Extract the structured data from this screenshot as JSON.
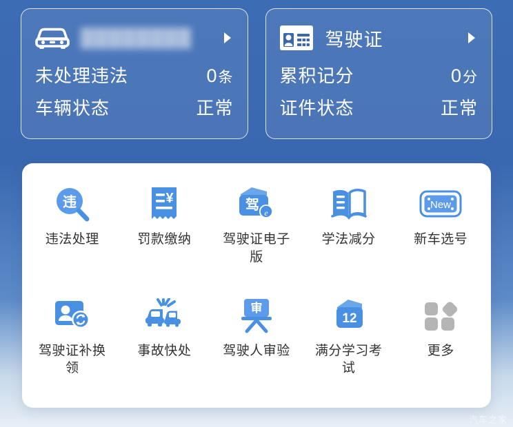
{
  "theme": {
    "bg_top": "#3c6cb4",
    "bg_bottom": "#e8eef5",
    "panel_bg": "#ffffff",
    "icon_blue": "#4a90e2",
    "icon_blue_dark": "#3b82d6",
    "icon_gray": "#b5b5b5",
    "label_color": "#333333",
    "card_text": "#ffffff"
  },
  "cards": [
    {
      "icon": "car-front-icon",
      "title": "████████",
      "title_redacted": true,
      "chevron": "chevron-right-icon",
      "rows": [
        {
          "label": "未处理违法",
          "value": "0",
          "unit": "条"
        },
        {
          "label": "车辆状态",
          "value": "正常",
          "unit": ""
        }
      ]
    },
    {
      "icon": "id-card-icon",
      "title": "驾驶证",
      "title_redacted": false,
      "chevron": "chevron-right-icon",
      "rows": [
        {
          "label": "累积记分",
          "value": "0",
          "unit": "分"
        },
        {
          "label": "证件状态",
          "value": "正常",
          "unit": ""
        }
      ]
    }
  ],
  "grid": {
    "tiles": [
      {
        "id": "violation-handling",
        "label": "违法处理",
        "icon": "violation-search-icon",
        "icon_text": "违"
      },
      {
        "id": "fine-payment",
        "label": "罚款缴纳",
        "icon": "receipt-yuan-icon",
        "icon_text": "¥"
      },
      {
        "id": "e-driver-license",
        "label": "驾驶证电子版",
        "icon": "e-license-wallet-icon",
        "icon_text": "驾"
      },
      {
        "id": "study-law-points",
        "label": "学法减分",
        "icon": "open-book-icon",
        "icon_text": ""
      },
      {
        "id": "new-plate-selection",
        "label": "新车选号",
        "icon": "new-plate-icon",
        "icon_text": "New"
      },
      {
        "id": "license-replacement",
        "label": "驾驶证补换领",
        "icon": "card-person-refresh-icon",
        "icon_text": ""
      },
      {
        "id": "accident-quick",
        "label": "事故快处",
        "icon": "crash-cars-icon",
        "icon_text": ""
      },
      {
        "id": "driver-review",
        "label": "驾驶人审验",
        "icon": "easel-review-icon",
        "icon_text": "审"
      },
      {
        "id": "full-points-study",
        "label": "满分学习考试",
        "icon": "twelve-points-icon",
        "icon_text": "12"
      },
      {
        "id": "more",
        "label": "更多",
        "icon": "more-squares-icon",
        "icon_text": ""
      }
    ]
  },
  "watermark": {
    "text": "汽车之家"
  }
}
